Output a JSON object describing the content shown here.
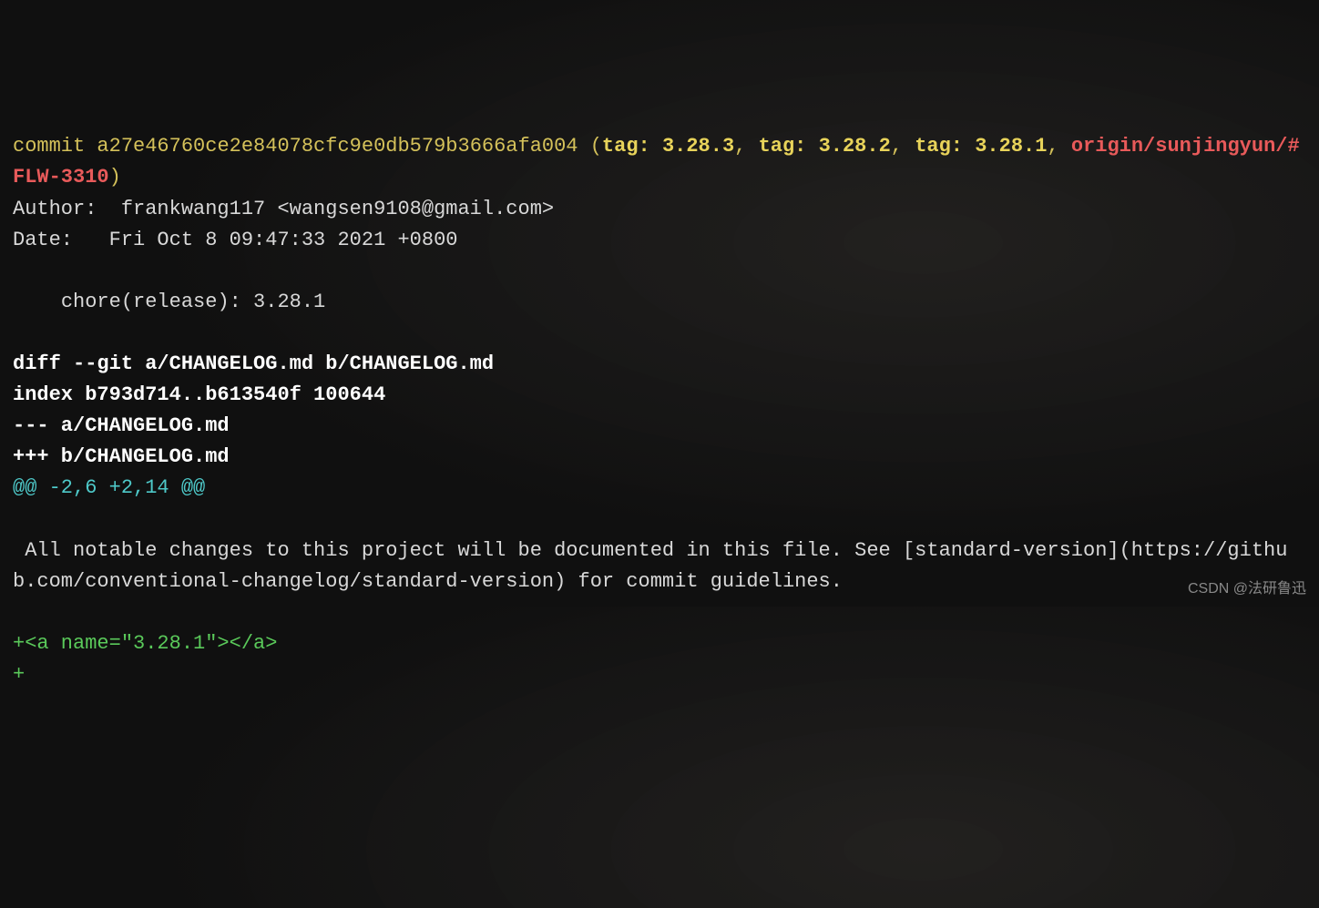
{
  "commit": {
    "label": "commit",
    "hash": "a27e46760ce2e84078cfc9e0db579b3666afa004",
    "paren_open": " (",
    "tag_label": "tag: ",
    "tags": [
      "3.28.3",
      "3.28.2",
      "3.28.1"
    ],
    "sep": ", ",
    "branch": "origin/sunjingyun/#FLW-3310",
    "paren_close": ")"
  },
  "author_line": "Author:  frankwang117 <wangsen9108@gmail.com>",
  "date_line": "Date:   Fri Oct 8 09:47:33 2021 +0800",
  "message": "    chore(release): 3.28.1",
  "diff": {
    "header": "diff --git a/CHANGELOG.md b/CHANGELOG.md",
    "index": "index b793d714..b613540f 100644",
    "minus": "--- a/CHANGELOG.md",
    "plus": "+++ b/CHANGELOG.md",
    "hunk": "@@ -2,6 +2,14 @@"
  },
  "context_line": " All notable changes to this project will be documented in this file. See [standard-version](https://github.com/conventional-changelog/standard-version) for commit guidelines.",
  "added_line": "+<a name=\"3.28.1\"></a>",
  "added_plus": "+",
  "watermark": "CSDN @法研鲁迅"
}
